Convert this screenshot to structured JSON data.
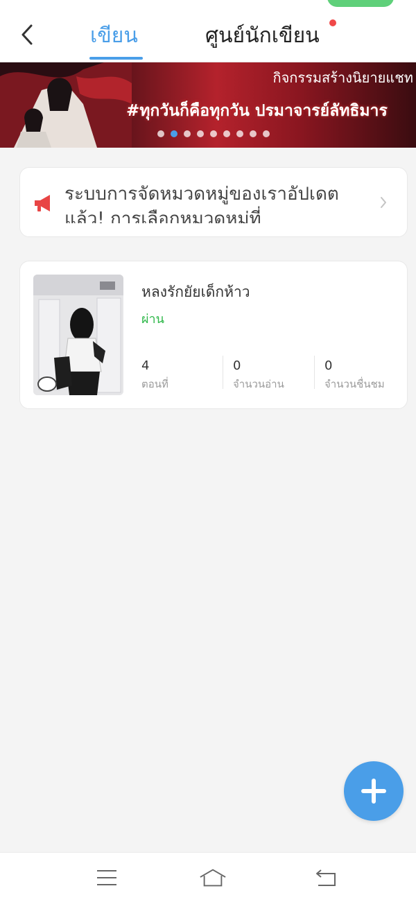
{
  "header": {
    "tab_write": "เขียน",
    "tab_writer_center": "ศูนย์นักเขียน",
    "back_icon": "chevron-left-icon"
  },
  "banner": {
    "top_text": "กิจกรรมสร้างนิยายแชท",
    "main_text": "#ทุกวันก็คือทุกวัน ปรมาจารย์ลัทธิมาร",
    "slide_count": 9,
    "active_slide": 1
  },
  "notice": {
    "icon": "megaphone-icon",
    "text": "ระบบการจัดหมวดหมู่ของเราอัปเดตแล้ว! การเลือกหมวดหมู่ที่",
    "chevron": "chevron-right-icon"
  },
  "novel": {
    "title": "หลงรักยัยเด็กห้าว",
    "status": "ผ่าน",
    "stats": [
      {
        "value": "4",
        "label": "ตอนที่"
      },
      {
        "value": "0",
        "label": "จำนวนอ่าน"
      },
      {
        "value": "0",
        "label": "จำนวนชื่นชม"
      }
    ]
  },
  "fab": {
    "icon": "plus-icon"
  },
  "colors": {
    "accent": "#4a9ee8",
    "status_green": "#2fb84a",
    "notification_red": "#f04848"
  },
  "navbar": {
    "items": [
      "menu-icon",
      "home-icon",
      "back-icon"
    ]
  }
}
